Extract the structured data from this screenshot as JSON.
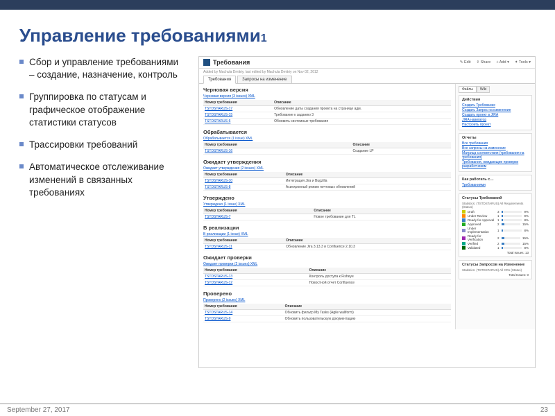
{
  "slide": {
    "title": "Управление требованиями",
    "title_sub": "1",
    "bullets": [
      "Сбор и управление требованиями – создание, назначение, контроль",
      "Группировка по статусам и графическое отображение статистики статусов",
      "Трассировки требований",
      "Автоматическое отслеживание изменений в связанных требованиях"
    ],
    "footer_date": "September 27, 2017",
    "footer_page": "23"
  },
  "shot": {
    "page_title": "Требования",
    "meta": "Added by Machula Dmitriy, last edited by Machula Dmitriy on Nov 02, 2012",
    "toolbar": {
      "edit": "✎ Edit",
      "share": "⇪ Share",
      "add": "+ Add ▾",
      "tools": "✦ Tools ▾"
    },
    "tabs": [
      "Требования",
      "Запросы на изменение"
    ],
    "side_tabs": [
      "Файлы",
      "Wiki"
    ],
    "cols": {
      "id": "Номер требования",
      "desc": "Описание"
    },
    "sections": [
      {
        "title": "Черновая версия",
        "sub": "Черновая версия (3 issues) XML",
        "rows": [
          {
            "id": "TSTDSTARUS-17",
            "desc": "Обновление даты создания проекта на странице адм."
          },
          {
            "id": "TSTDSTARUS-15",
            "desc": "Требование к заданию 3"
          },
          {
            "id": "TSTDSTARUS-6",
            "desc": "Обновить системные требования"
          }
        ]
      },
      {
        "title": "Обрабатывается",
        "sub": "Обрабатывается (1 issue) XML",
        "rows": [
          {
            "id": "TSTDSTARUS-16",
            "desc": "Создание LP"
          }
        ]
      },
      {
        "title": "Ожидает утверждения",
        "sub": "Ожидает утверждения (2 issues) XML",
        "rows": [
          {
            "id": "TSTDSTARUS-10",
            "desc": "Интеграция Jira и Bugzilla"
          },
          {
            "id": "TSTDSTARUS-8",
            "desc": "Асинхронный режим почтовых обновлений"
          }
        ]
      },
      {
        "title": "Утверждено",
        "sub": "Утверждено (1 issue) XML",
        "rows": [
          {
            "id": "TSTDSTARUS-7",
            "desc": "Новое требование для TL"
          }
        ]
      },
      {
        "title": "В реализации",
        "sub": "В реализации (1 issue) XML",
        "rows": [
          {
            "id": "TSTDSTARUS-11",
            "desc": "Обновление Jira 3.13.3 и Confluence 2.10.3"
          }
        ]
      },
      {
        "title": "Ожидает проверки",
        "sub": "Ожидает проверки (2 issues) XML",
        "rows": [
          {
            "id": "TSTDSTARUS-13",
            "desc": "Контроль доступа к Fisheye"
          },
          {
            "id": "TSTDSTARUS-12",
            "desc": "Новостной отчет Confluence"
          }
        ]
      },
      {
        "title": "Проверено",
        "sub": "Проверено (2 issues) XML",
        "rows": [
          {
            "id": "TSTDSTARUS-14",
            "desc": "Обновить фильтр My Tasks (Agile wallform)"
          },
          {
            "id": "TSTDSTARUS-9",
            "desc": "Обновить пользовательскую документацию"
          }
        ]
      }
    ],
    "side": {
      "actions": {
        "title": "Действия",
        "links": [
          "Создать Требование",
          "Создать Запрос на изменение",
          "Создать проект в JIRA",
          "JIRA навигатор",
          "Настроить проект"
        ]
      },
      "reports": {
        "title": "Отчеты",
        "links": [
          "Все требования",
          "Все запросы на изменение",
          "Матрица соответствия (требования на требования)",
          "Требования, ожидающие проверки разработчиком"
        ]
      },
      "howto": {
        "title": "Как работать с…",
        "link": "Требованиями"
      },
      "stats_req": {
        "title": "Статусы Требований",
        "head": "Statistics: (TSTDSTARUS) All Requirements (Status)",
        "rows": [
          {
            "name": "Draft",
            "n": "3",
            "pct": "9%",
            "color": "#cccc00",
            "w": 9
          },
          {
            "name": "Under Review",
            "n": "1",
            "pct": "9%",
            "color": "#ff8800",
            "w": 9
          },
          {
            "name": "Ready for Approval",
            "n": "1",
            "pct": "8%",
            "color": "#3b7fc4",
            "w": 8
          },
          {
            "name": "Approved",
            "n": "2",
            "pct": "15%",
            "color": "#22aa22",
            "w": 15
          },
          {
            "name": "Under Implementation",
            "n": "1",
            "pct": "8%",
            "color": "#8888cc",
            "w": 8
          },
          {
            "name": "Ready for Verification",
            "n": "2",
            "pct": "15%",
            "color": "#9c27b0",
            "w": 15
          },
          {
            "name": "Verified",
            "n": "2",
            "pct": "15%",
            "color": "#00aa88",
            "w": 15
          },
          {
            "name": "Validated",
            "n": "1",
            "pct": "8%",
            "color": "#006600",
            "w": 8
          }
        ],
        "total": "Total Issues: 13"
      },
      "stats_cr": {
        "title": "Статусы Запросов на Изменение",
        "head": "Statistics: (TSTDSTARUS) All CRs (Status)",
        "total": "Total Issues: 0"
      }
    }
  }
}
